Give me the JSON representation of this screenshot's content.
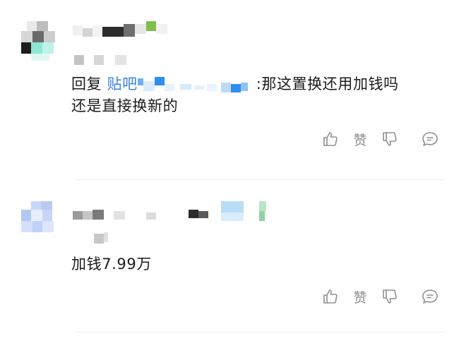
{
  "comments": [
    {
      "reply_prefix": "回复",
      "mention": "贴吧",
      "body_line1": ":那这置换还用加钱吗",
      "body_line2": "还是直接换新的",
      "like_label": "赞"
    },
    {
      "body_line1": "加钱7.99万",
      "like_label": "赞"
    }
  ],
  "colors": {
    "text": "#1b1b1b",
    "mention": "#3a82e0",
    "icon": "#8f8f8f",
    "divider": "#efefef"
  },
  "icons": [
    "thumb-up-icon",
    "thumb-down-icon",
    "comment-bubble-icon"
  ]
}
